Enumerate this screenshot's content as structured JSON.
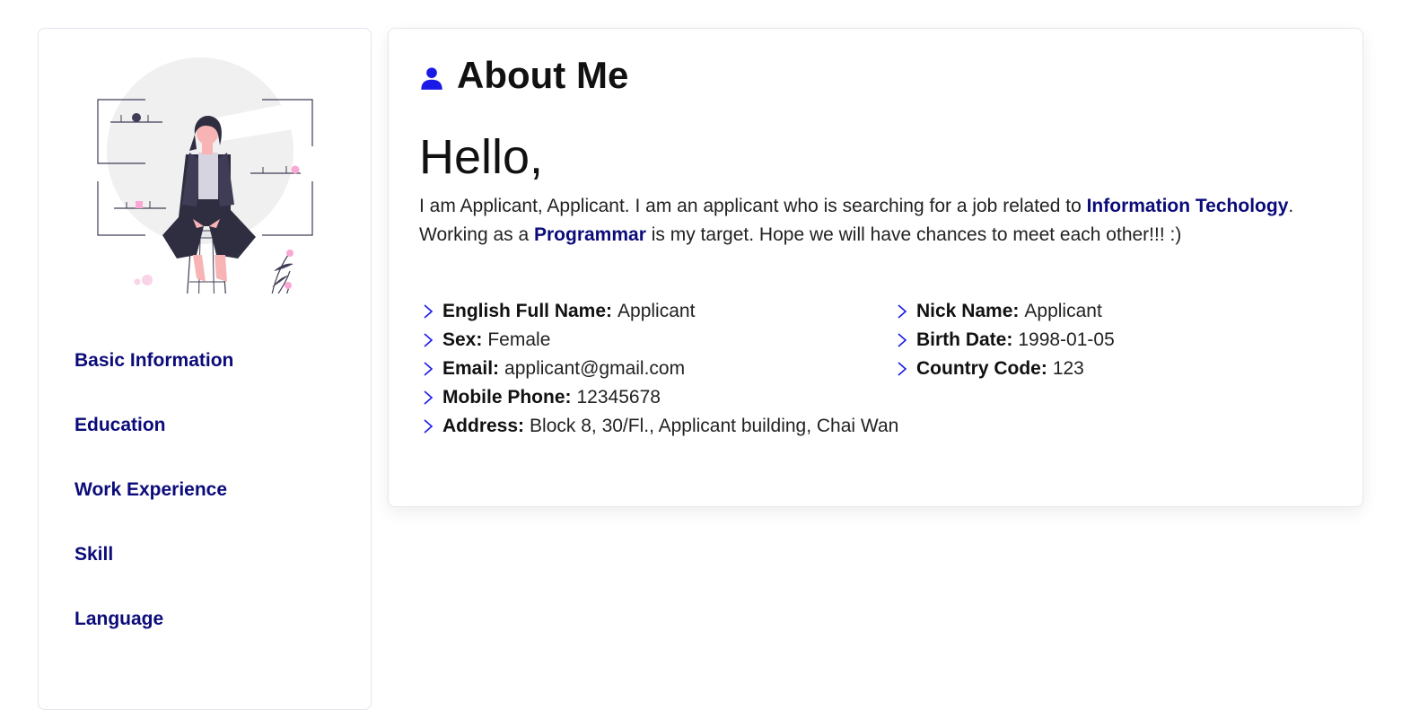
{
  "sidebar": {
    "nav": [
      {
        "label": "Basic Information"
      },
      {
        "label": "Education"
      },
      {
        "label": "Work Experience"
      },
      {
        "label": "Skill"
      },
      {
        "label": "Language"
      }
    ]
  },
  "about": {
    "title": "About Me",
    "greeting": "Hello,",
    "intro_part1": "I am Applicant, Applicant. I am an applicant who is searching for a job related to ",
    "intro_field": "Information Techology",
    "intro_part2": ". Working as a ",
    "intro_role": "Programmar",
    "intro_part3": " is my target. Hope we will have chances to meet each other!!! :)"
  },
  "details_left": [
    {
      "label": "English Full Name:",
      "value": "Applicant"
    },
    {
      "label": "Sex:",
      "value": "Female"
    },
    {
      "label": "Email:",
      "value": "applicant@gmail.com"
    },
    {
      "label": "Mobile Phone:",
      "value": "12345678"
    },
    {
      "label": "Address:",
      "value": "Block 8, 30/Fl., Applicant building, Chai Wan"
    }
  ],
  "details_right": [
    {
      "label": "Nick Name:",
      "value": "Applicant"
    },
    {
      "label": "Birth Date:",
      "value": "1998-01-05"
    },
    {
      "label": "Country Code:",
      "value": "123"
    }
  ],
  "icons": {
    "title_icon": "person-icon",
    "bullet_icon": "chevron-right-icon",
    "illustration": "woman-on-stool-illustration"
  },
  "colors": {
    "accent": "#1a1ae6",
    "link": "#0b0b7a",
    "highlight_pink": "#f9a8d4"
  }
}
